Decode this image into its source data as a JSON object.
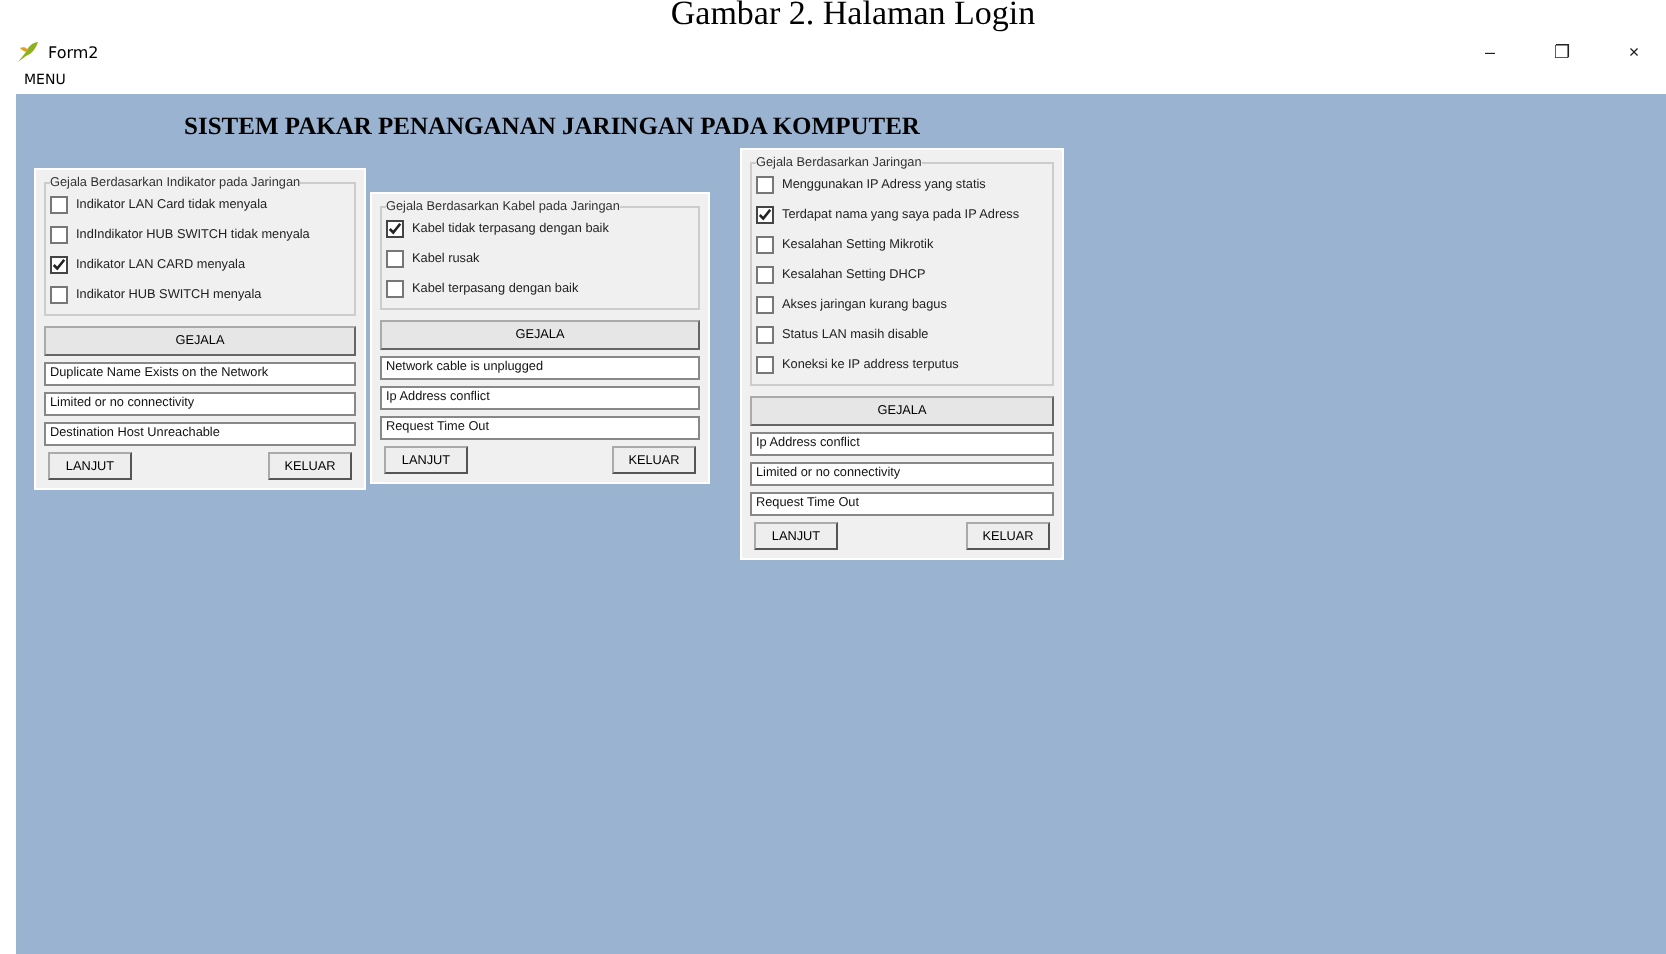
{
  "caption": "Gambar 2. Halaman Login",
  "window": {
    "title": "Form2",
    "controls": [
      "–",
      "❐",
      "×"
    ]
  },
  "menu": [
    "MENU"
  ],
  "heading": "SISTEM PAKAR PENANGANAN JARINGAN PADA KOMPUTER",
  "panels": [
    {
      "legend": "Gejala Berdasarkan Indikator pada Jaringan",
      "options": [
        {
          "label": "Indikator LAN Card tidak menyala",
          "checked": false
        },
        {
          "label": "IndIndikator HUB SWITCH tidak menyala",
          "checked": false
        },
        {
          "label": "Indikator LAN CARD menyala",
          "checked": true
        },
        {
          "label": "Indikator HUB SWITCH menyala",
          "checked": false
        }
      ],
      "action": "GEJALA",
      "results": [
        "Duplicate Name Exists on the Network",
        "Limited or no connectivity",
        "Destination Host Unreachable"
      ],
      "buttons": [
        "LANJUT",
        "KELUAR"
      ]
    },
    {
      "legend": "Gejala Berdasarkan Kabel pada Jaringan",
      "options": [
        {
          "label": "Kabel tidak terpasang dengan baik",
          "checked": true
        },
        {
          "label": "Kabel rusak",
          "checked": false
        },
        {
          "label": "Kabel terpasang dengan baik",
          "checked": false
        }
      ],
      "action": "GEJALA",
      "results": [
        "Network cable is unplugged",
        "Ip Address conflict",
        "Request Time Out"
      ],
      "buttons": [
        "LANJUT",
        "KELUAR"
      ]
    },
    {
      "legend": "Gejala Berdasarkan Jaringan",
      "options": [
        {
          "label": "Menggunakan IP Adress yang statis",
          "checked": false
        },
        {
          "label": "Terdapat nama yang saya pada IP Adress",
          "checked": true
        },
        {
          "label": "Kesalahan Setting Mikrotik",
          "checked": false
        },
        {
          "label": "Kesalahan Setting DHCP",
          "checked": false
        },
        {
          "label": "Akses jaringan kurang bagus",
          "checked": false
        },
        {
          "label": "Status LAN masih disable",
          "checked": false
        },
        {
          "label": "Koneksi ke IP address terputus",
          "checked": false
        }
      ],
      "action": "GEJALA",
      "results": [
        "Ip Address conflict",
        "Limited or no connectivity",
        "Request Time Out"
      ],
      "buttons": [
        "LANJUT",
        "KELUAR"
      ]
    }
  ]
}
